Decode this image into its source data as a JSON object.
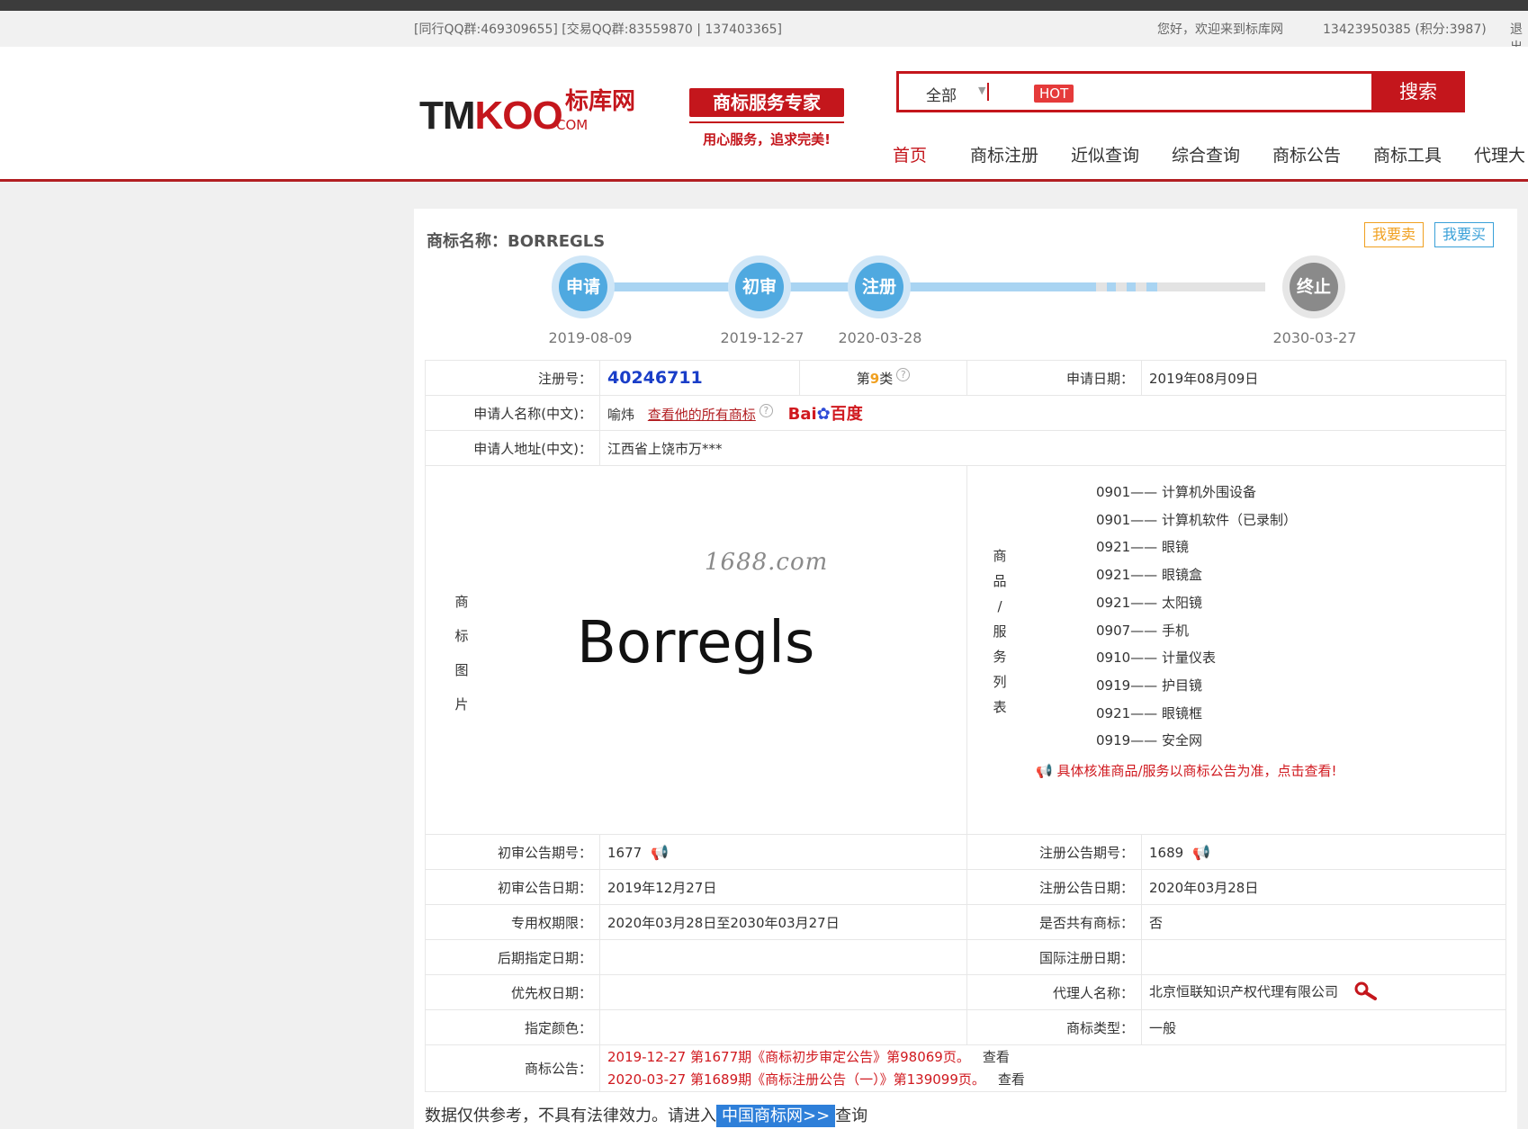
{
  "topbar": {
    "qq": "[同行QQ群:469309655] [交易QQ群:83559870 | 137403365]",
    "welcome": "您好，欢迎来到标库网",
    "user": "13423950385 (积分:3987)",
    "logout": "退出"
  },
  "header": {
    "logo_en": "TMKOO",
    "logo_cn": "标库网",
    "logo_com": ".COM",
    "slogan_title": "商标服务专家",
    "slogan_sub": "用心服务，追求完美!",
    "search_scope": "全部",
    "search_placeholder": "",
    "hot_badge": "HOT",
    "search_button": "搜索",
    "nav": [
      "首页",
      "商标注册",
      "近似查询",
      "综合查询",
      "商标公告",
      "商标工具",
      "代理大"
    ]
  },
  "trademark": {
    "name_label": "商标名称：BORREGLS",
    "sell_button": "我要卖",
    "buy_button": "我要买",
    "timeline": [
      {
        "label": "申请",
        "date": "2019-08-09"
      },
      {
        "label": "初审",
        "date": "2019-12-27"
      },
      {
        "label": "注册",
        "date": "2020-03-28"
      },
      {
        "label": "终止",
        "date": "2030-03-27"
      }
    ],
    "reg_no_label": "注册号：",
    "reg_no": "40246711",
    "class_prefix": "第",
    "class_num": "9",
    "class_suffix": "类",
    "apply_date_label": "申请日期：",
    "apply_date": "2019年08月09日",
    "applicant_label": "申请人名称(中文)：",
    "applicant": "喻炜",
    "applicant_link": "查看他的所有商标",
    "baidu": "Bai",
    "baidu_cn": "百度",
    "address_label": "申请人地址(中文)：",
    "address": "江西省上饶市万***",
    "image_label_chars": [
      "商",
      "标",
      "图",
      "片"
    ],
    "watermark": "1688.com",
    "mark_text": "Borregls",
    "goods_label_chars": [
      "商",
      "品",
      "/",
      "服",
      "务",
      "列",
      "表"
    ],
    "goods": [
      "0901—— 计算机外围设备",
      "0901—— 计算机软件（已录制）",
      "0921—— 眼镜",
      "0921—— 眼镜盒",
      "0921—— 太阳镜",
      "0907—— 手机",
      "0910—— 计量仪表",
      "0919—— 护目镜",
      "0921—— 眼镜框",
      "0919—— 安全网"
    ],
    "goods_note": "具体核准商品/服务以商标公告为准，点击查看!",
    "rows": [
      {
        "l1": "初审公告期号：",
        "v1": "1677",
        "l2": "注册公告期号：",
        "v2": "1689"
      },
      {
        "l1": "初审公告日期：",
        "v1": "2019年12月27日",
        "l2": "注册公告日期：",
        "v2": "2020年03月28日"
      },
      {
        "l1": "专用权期限：",
        "v1": "2020年03月28日至2030年03月27日",
        "l2": "是否共有商标：",
        "v2": "否"
      },
      {
        "l1": "后期指定日期：",
        "v1": "",
        "l2": "国际注册日期：",
        "v2": ""
      },
      {
        "l1": "优先权日期：",
        "v1": "",
        "l2": "代理人名称：",
        "v2": "北京恒联知识产权代理有限公司"
      },
      {
        "l1": "指定颜色：",
        "v1": "",
        "l2": "商标类型：",
        "v2": "一般"
      }
    ],
    "announce_label": "商标公告：",
    "announcements": [
      {
        "text": "2019-12-27 第1677期《商标初步审定公告》第98069页。",
        "view": "查看"
      },
      {
        "text": "2020-03-27 第1689期《商标注册公告（一）》第139099页。",
        "view": "查看"
      }
    ],
    "footer_pre": "数据仅供参考，不具有法律效力。请进入",
    "footer_link": "中国商标网>>",
    "footer_post": "查询"
  }
}
